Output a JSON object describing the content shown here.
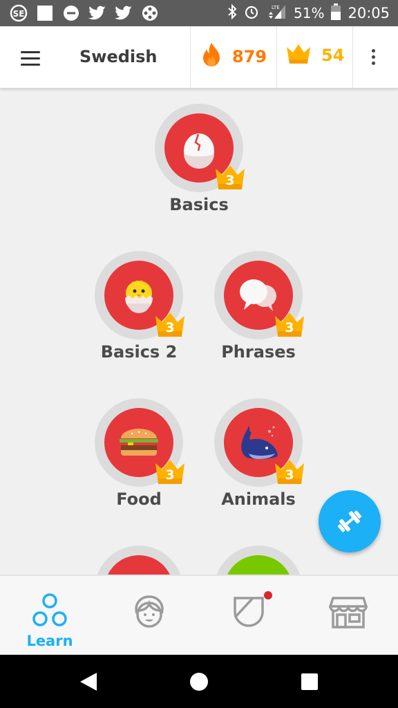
{
  "status_bar": {
    "battery": "51%",
    "time": "20:05",
    "network": "LTE"
  },
  "header": {
    "course": "Swedish",
    "streak": "879",
    "crowns": "54"
  },
  "skills": [
    {
      "name": "Basics",
      "crown_level": "3",
      "icon": "egg-icon"
    },
    {
      "name": "Basics 2",
      "crown_level": "3",
      "icon": "chick-icon"
    },
    {
      "name": "Phrases",
      "crown_level": "3",
      "icon": "speech-bubbles-icon"
    },
    {
      "name": "Food",
      "crown_level": "3",
      "icon": "burger-icon"
    },
    {
      "name": "Animals",
      "crown_level": "3",
      "icon": "whale-icon"
    }
  ],
  "nav": {
    "learn": "Learn",
    "profile": "",
    "leagues": "",
    "shop": ""
  },
  "colors": {
    "skill_red": "#e5383b",
    "crown_gold": "#ffb100",
    "streak_orange": "#ff7a00",
    "accent_blue": "#1cb0f6",
    "green": "#78c800"
  }
}
